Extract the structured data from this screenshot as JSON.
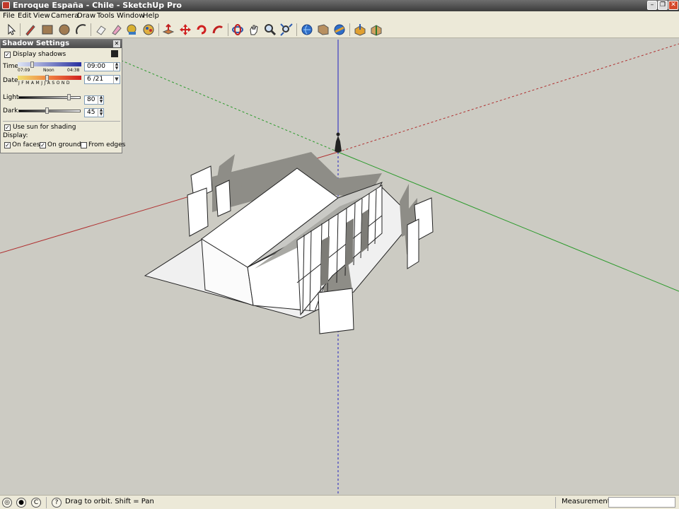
{
  "window": {
    "title": "Enroque España - Chile - SketchUp Pro"
  },
  "menu": [
    "File",
    "Edit",
    "View",
    "Camera",
    "Draw",
    "Tools",
    "Window",
    "Help"
  ],
  "toolbar": {
    "tools": [
      "select-icon",
      "pencil-icon",
      "rectangle-icon",
      "circle-icon",
      "arc-icon",
      "eraser-icon",
      "paint-bucket-icon",
      "tape-measure-icon",
      "paint-icon",
      "push-pull-icon",
      "move-icon",
      "rotate-icon",
      "follow-me-icon",
      "orbit-icon",
      "pan-icon",
      "zoom-icon",
      "zoom-extents-icon",
      "get-models-icon",
      "share-model-icon",
      "components-icon",
      "section-icon",
      "materials-icon"
    ]
  },
  "shadow_panel": {
    "title": "Shadow Settings",
    "display_shadows_label": "Display shadows",
    "display_shadows_checked": true,
    "time_label": "Time",
    "time_start": "07:09",
    "time_noon": "Noon",
    "time_end": "04:38",
    "time_value": "09:00",
    "date_label": "Date",
    "months": "J F M A M J J A S O N D",
    "date_value": "6 /21",
    "light_label": "Light",
    "light_value": "80",
    "light_level": 0.8,
    "dark_label": "Dark",
    "dark_value": "45",
    "dark_level": 0.45,
    "use_sun_label": "Use sun for shading",
    "use_sun_checked": true,
    "display_label": "Display:",
    "on_faces_label": "On faces",
    "on_faces_checked": true,
    "on_ground_label": "On ground",
    "on_ground_checked": true,
    "from_edges_label": "From edges",
    "from_edges_checked": false
  },
  "status": {
    "message": "Drag to orbit.  Shift = Pan",
    "measurements_label": "Measurements",
    "measurements_value": ""
  },
  "colors": {
    "viewport_bg": "#cccbc3",
    "axis_red": "#b03030",
    "axis_green": "#2a9a2a",
    "axis_blue": "#2020c0"
  }
}
